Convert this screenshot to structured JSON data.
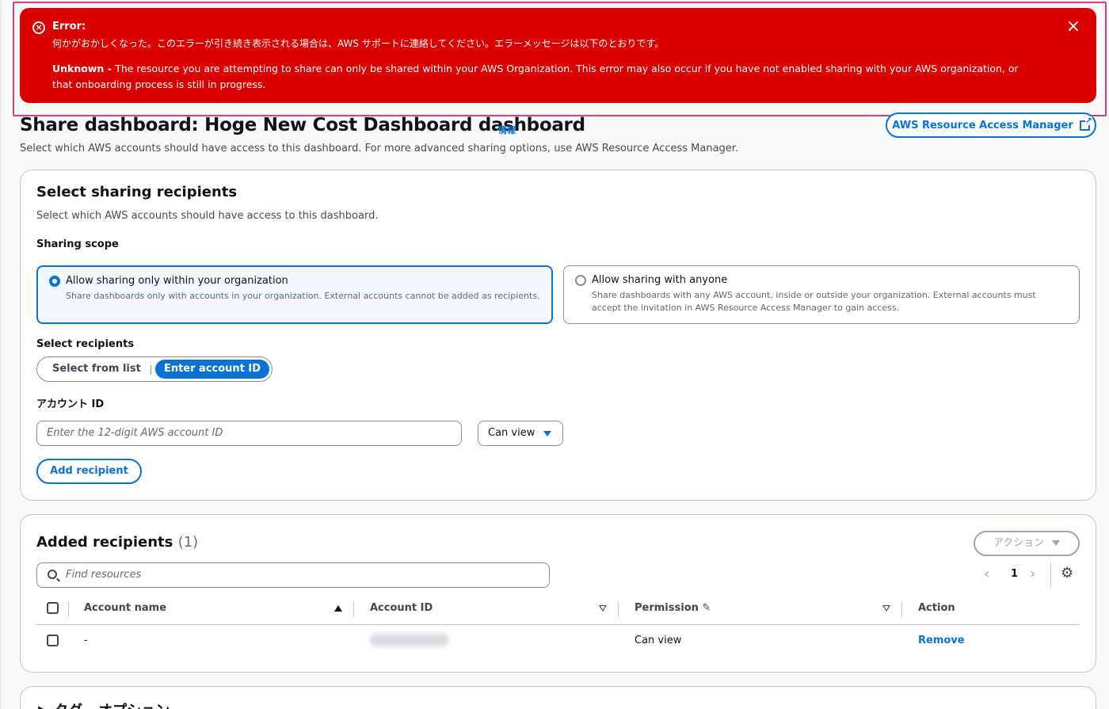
{
  "error": {
    "title": "Error:",
    "message": "何かがおかしくなった。このエラーが引き続き表示される場合は、AWS サポートに連絡してください。エラーメッセージは以下のとおりです。",
    "detail_prefix": "Unknown - ",
    "detail": "The resource you are attempting to share can only be shared within your AWS Organization. This error may also occur if you have not enabled sharing with your AWS organization, or that onboarding process is still in progress.",
    "close_label": "×"
  },
  "header": {
    "title": "Share dashboard: Hoge New Cost Dashboard dashboard",
    "info_link": "情報",
    "description": "Select which AWS accounts should have access to this dashboard. For more advanced sharing options, use AWS Resource Access Manager.",
    "ram_button": "AWS Resource Access Manager"
  },
  "recipients_section": {
    "title": "Select sharing recipients",
    "description": "Select which AWS accounts should have access to this dashboard.",
    "scope_label": "Sharing scope",
    "scope_options": [
      {
        "label": "Allow sharing only within your organization",
        "description": "Share dashboards only with accounts in your organization. External accounts cannot be added as recipients.",
        "selected": true
      },
      {
        "label": "Allow sharing with anyone",
        "description": "Share dashboards with any AWS account, inside or outside your organization. External accounts must accept the invitation in AWS Resource Access Manager to gain access.",
        "selected": false
      }
    ],
    "select_recipients_label": "Select recipients",
    "segments": [
      "Select from list",
      "Enter account ID"
    ],
    "selected_segment": "Enter account ID",
    "account_id_label": "アカウント ID",
    "account_id_placeholder": "Enter the 12-digit AWS account ID",
    "account_id_value": "",
    "permission_select": "Can view",
    "add_button": "Add recipient"
  },
  "added_section": {
    "title": "Added recipients",
    "count": "(1)",
    "actions_button": "アクション",
    "search_placeholder": "Find resources",
    "page": "1",
    "columns": [
      "Account name",
      "Account ID",
      "Permission",
      "Action"
    ],
    "rows": [
      {
        "account_name": "-",
        "account_id": "",
        "permission": "Can view",
        "action": "Remove"
      }
    ]
  },
  "tags_section": {
    "title": "タグ - オプション"
  },
  "colors": {
    "error_bg": "#db0000",
    "primary": "#0972d3",
    "highlight_border": "#e6397c"
  }
}
